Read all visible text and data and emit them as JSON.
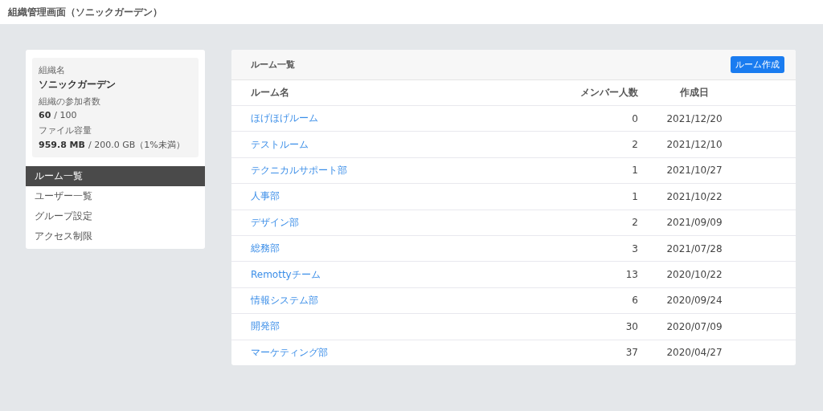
{
  "header": {
    "title": "組織管理画面（ソニックガーデン）"
  },
  "org": {
    "name_label": "組織名",
    "name": "ソニックガーデン",
    "members_label": "組織の参加者数",
    "members": "60",
    "members_max": "/ 100",
    "storage_label": "ファイル容量",
    "storage": "959.8 MB",
    "storage_max": "/ 200.0 GB（1%未満）"
  },
  "sidebar": {
    "items": [
      {
        "label": "ルーム一覧",
        "selected": true
      },
      {
        "label": "ユーザー一覧",
        "selected": false
      },
      {
        "label": "グループ設定",
        "selected": false
      },
      {
        "label": "アクセス制限",
        "selected": false
      }
    ]
  },
  "panel": {
    "title": "ルーム一覧",
    "create_button": "ルーム作成"
  },
  "table": {
    "columns": [
      "ルーム名",
      "メンバー人数",
      "作成日"
    ],
    "rows": [
      {
        "name": "ほげほげルーム",
        "members": "0",
        "created": "2021/12/20"
      },
      {
        "name": "テストルーム",
        "members": "2",
        "created": "2021/12/10"
      },
      {
        "name": "テクニカルサポート部",
        "members": "1",
        "created": "2021/10/27"
      },
      {
        "name": "人事部",
        "members": "1",
        "created": "2021/10/22"
      },
      {
        "name": "デザイン部",
        "members": "2",
        "created": "2021/09/09"
      },
      {
        "name": "総務部",
        "members": "3",
        "created": "2021/07/28"
      },
      {
        "name": "Remottyチーム",
        "members": "13",
        "created": "2020/10/22"
      },
      {
        "name": "情報システム部",
        "members": "6",
        "created": "2020/09/24"
      },
      {
        "name": "開発部",
        "members": "30",
        "created": "2020/07/09"
      },
      {
        "name": "マーケティング部",
        "members": "37",
        "created": "2020/04/27"
      }
    ]
  }
}
